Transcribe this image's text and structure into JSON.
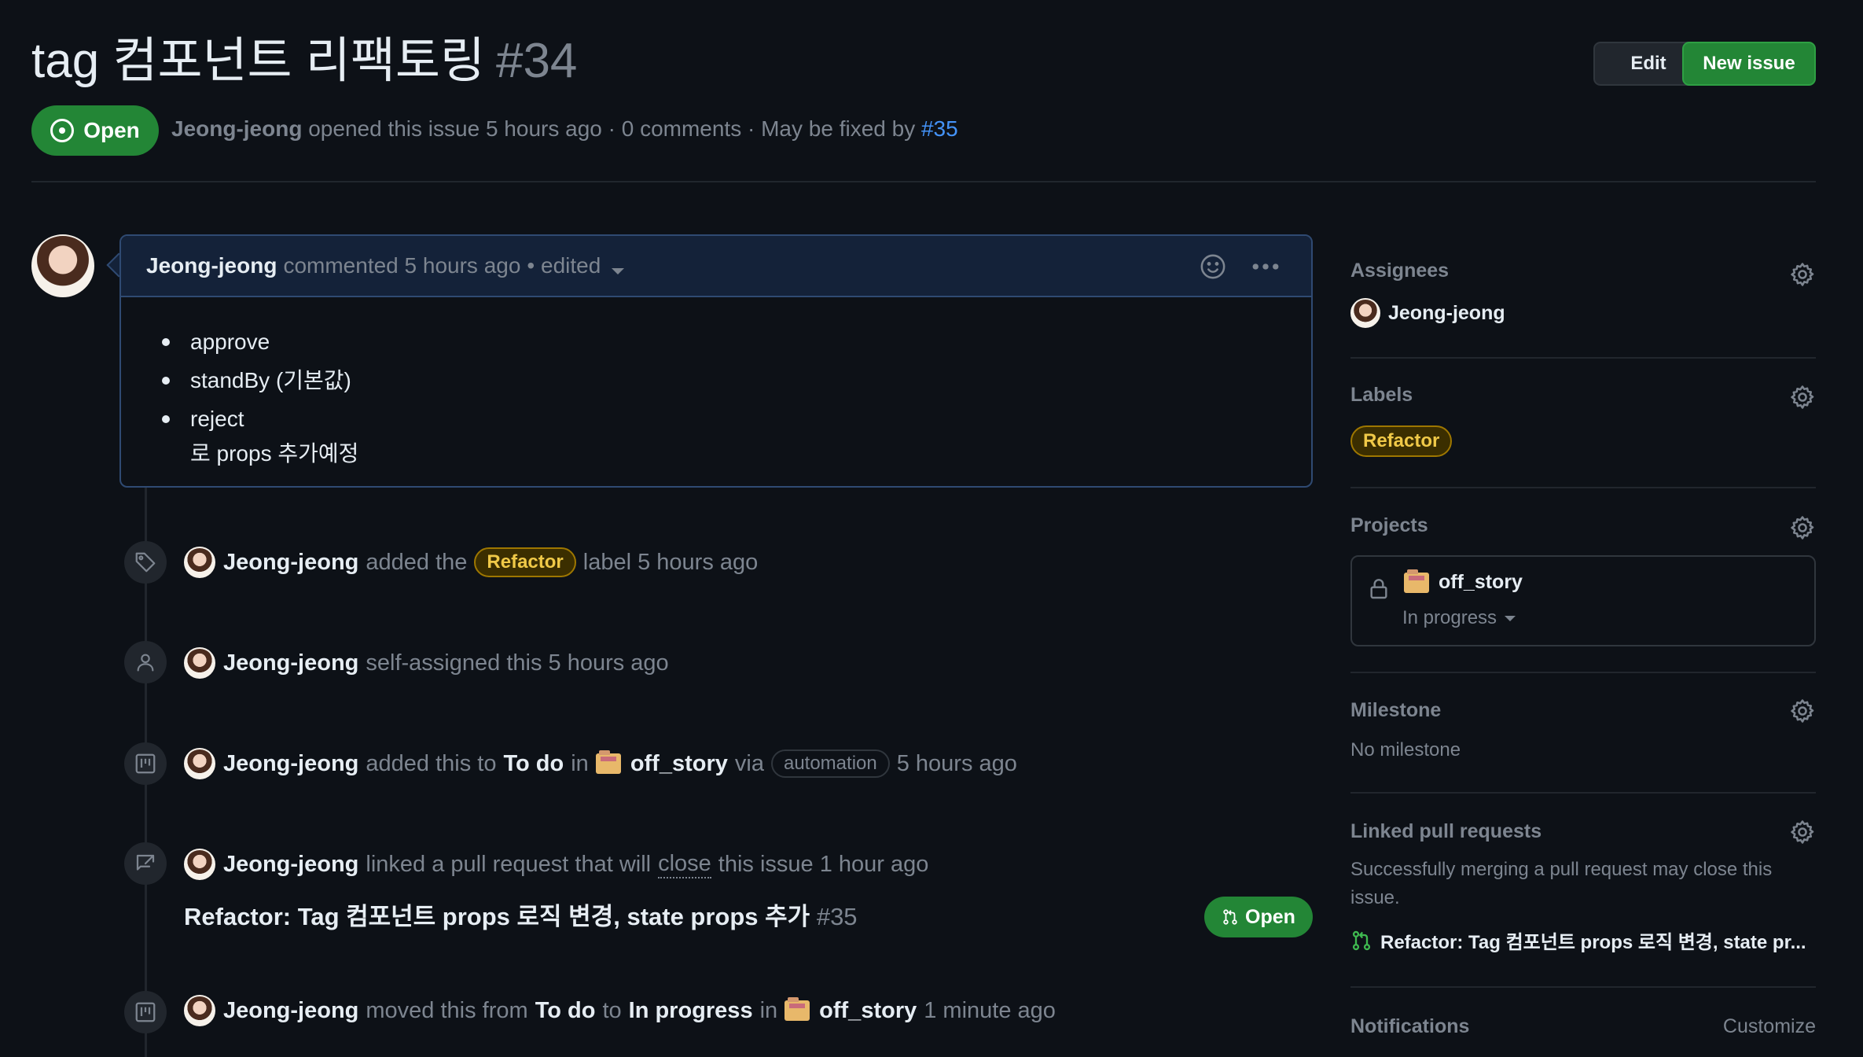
{
  "header": {
    "title": "tag 컴포넌트 리팩토링",
    "number": "#34",
    "edit_label": "Edit",
    "new_issue_label": "New issue",
    "state_label": "Open",
    "author": "Jeong-jeong",
    "meta_text": "opened this issue 5 hours ago · 0 comments · May be fixed by",
    "fixed_by_link": "#35"
  },
  "comment": {
    "author": "Jeong-jeong",
    "action": "commented 5 hours ago",
    "edited": "• edited",
    "items": [
      "approve",
      "standBy (기본값)",
      "reject"
    ],
    "continuation": "로 props 추가예정"
  },
  "timeline": {
    "label_event": {
      "actor": "Jeong-jeong",
      "text_before": "added the",
      "label": "Refactor",
      "text_after": "label 5 hours ago"
    },
    "assign_event": {
      "actor": "Jeong-jeong",
      "text": "self-assigned this 5 hours ago"
    },
    "project_add_event": {
      "actor": "Jeong-jeong",
      "text1": "added this to",
      "column": "To do",
      "text2": "in",
      "project": "off_story",
      "text3": "via",
      "via": "automation",
      "time": "5 hours ago"
    },
    "link_event": {
      "actor": "Jeong-jeong",
      "text1": "linked a pull request that will",
      "close_word": "close",
      "text2": "this issue 1 hour ago",
      "pr_title": "Refactor: Tag 컴포넌트 props 로직 변경, state props 추가",
      "pr_number": "#35",
      "pr_state": "Open"
    },
    "move_event": {
      "actor": "Jeong-jeong",
      "text1": "moved this from",
      "from": "To do",
      "text2": "to",
      "to": "In progress",
      "text3": "in",
      "project": "off_story",
      "time": "1 minute ago"
    }
  },
  "sidebar": {
    "assignees": {
      "title": "Assignees",
      "user": "Jeong-jeong"
    },
    "labels": {
      "title": "Labels",
      "label": "Refactor"
    },
    "projects": {
      "title": "Projects",
      "name": "off_story",
      "status": "In progress"
    },
    "milestone": {
      "title": "Milestone",
      "value": "No milestone"
    },
    "linked_prs": {
      "title": "Linked pull requests",
      "description": "Successfully merging a pull request may close this issue.",
      "pr": "Refactor: Tag 컴포넌트 props 로직 변경, state pr..."
    },
    "notifications": {
      "title": "Notifications",
      "customize": "Customize"
    }
  },
  "colors": {
    "background": "#0d1117",
    "accent_green": "#238636",
    "link_blue": "#4493f8",
    "label_yellow": "#f0c948"
  }
}
